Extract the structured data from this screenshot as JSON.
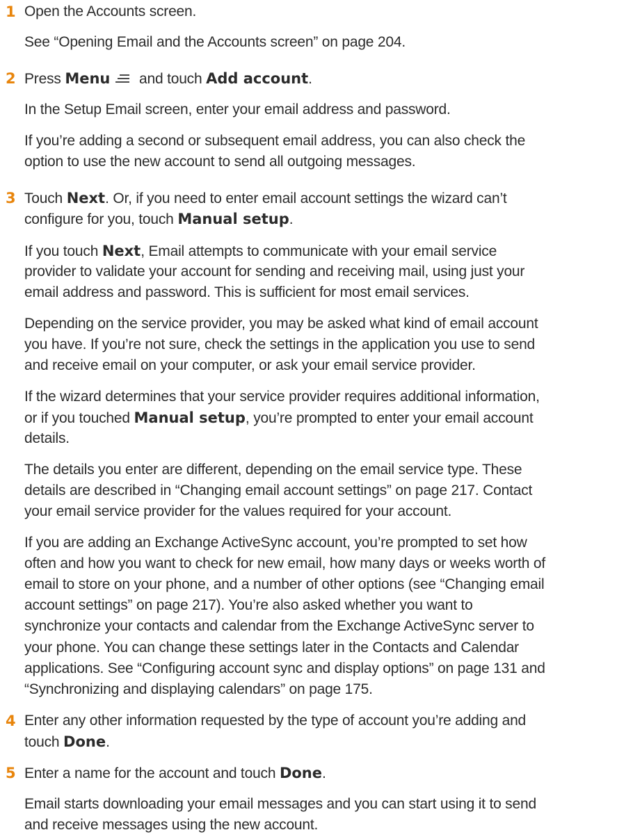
{
  "steps": {
    "s1": {
      "num": "1",
      "text": "Open the Accounts screen."
    },
    "s1_ref": "See “Opening Email and the Accounts screen” on page 204.",
    "s2": {
      "num": "2",
      "press": "Press ",
      "menu": "Menu",
      "and_touch": " and touch ",
      "add_account": "Add account",
      "period": "."
    },
    "s2_p1": "In the Setup Email screen, enter your email address and password.",
    "s2_p2": [
      "If you’re adding a second or subsequent email address, you can also check the",
      "option to use the new account to send all outgoing messages."
    ],
    "s3": {
      "num": "3",
      "touch": "Touch ",
      "next": "Next",
      "line1_rest": ". Or, if you need to enter email account settings the wizard can’t",
      "line2_pre": "configure for you, touch ",
      "manual_setup": "Manual setup",
      "period": "."
    },
    "s3_p1": {
      "line1_pre": "If you touch ",
      "next": "Next",
      "line1_rest": ", Email attempts to communicate with your email service",
      "line2": "provider to validate your account for sending and receiving mail, using just your",
      "line3": "email address and password. This is sufficient for most email services."
    },
    "s3_p2": [
      "Depending on the service provider, you may be asked what kind of email account",
      "you have. If you’re not sure, check the settings in the application you use to send",
      "and receive email on your computer, or ask your email service provider."
    ],
    "s3_p3": {
      "line1": "If the wizard determines that your service provider requires additional information,",
      "line2_pre": "or if you touched ",
      "manual_setup": "Manual setup",
      "line2_rest": ", you’re prompted to enter your email account",
      "line3": "details."
    },
    "s3_p4": [
      "The details you enter are different, depending on the email service type. These",
      "details are described in “Changing email account settings” on page 217. Contact",
      "your email service provider for the values required for your account."
    ],
    "s3_p5": [
      "If you are adding an Exchange ActiveSync account, you’re prompted to set how",
      "often and how you want to check for new email, how many days or weeks worth of",
      "email to store on your phone, and a number of other options (see “Changing email",
      "account settings” on page 217). You’re also asked whether you want to",
      "synchronize your contacts and calendar from the Exchange ActiveSync server to",
      "your phone. You can change these settings later in the Contacts and Calendar",
      "applications. See “Configuring account sync and display options” on page 131 and",
      "“Synchronizing and displaying calendars” on page 175."
    ],
    "s4": {
      "num": "4",
      "line1": "Enter any other information requested by the type of account you’re adding and",
      "line2_pre": "touch ",
      "done": "Done",
      "period": "."
    },
    "s5": {
      "num": "5",
      "pre": "Enter a name for the account and touch ",
      "done": "Done",
      "period": "."
    },
    "s5_p1": [
      "Email starts downloading your email messages and you can start using it to send",
      "and receive messages using the new account."
    ]
  },
  "icons": {
    "menu": "menu-icon"
  },
  "colors": {
    "step_number": "#e8850c",
    "text": "#2b2b2b"
  }
}
